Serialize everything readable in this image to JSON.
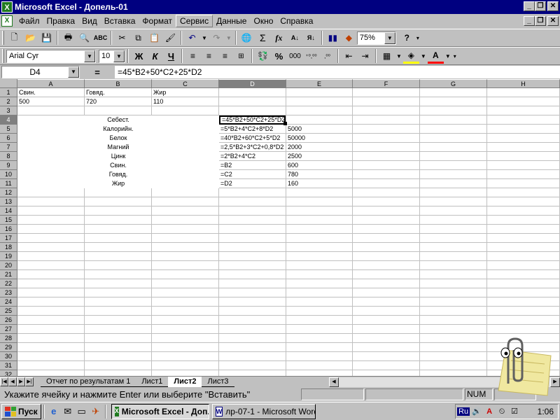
{
  "window": {
    "title": "Microsoft Excel - Допель-01",
    "app_icon": "X"
  },
  "menu": [
    "Файл",
    "Правка",
    "Вид",
    "Вставка",
    "Формат",
    "Сервис",
    "Данные",
    "Окно",
    "Справка"
  ],
  "toolbar": {
    "zoom": "75%",
    "font_name": "Arial Cyr",
    "font_size": "10",
    "bold": "Ж",
    "italic": "К",
    "underline": "Ч",
    "percent": "%",
    "thousands": "000",
    "inc_decimal": "⁺⁰,⁰⁰",
    "dec_decimal": ",⁰⁰",
    "sigma": "Σ",
    "fx": "fx"
  },
  "formula_bar": {
    "name_box": "D4",
    "equals": "=",
    "formula": "=45*B2+50*C2+25*D2"
  },
  "grid": {
    "columns": [
      "A",
      "B",
      "C",
      "D",
      "E",
      "F",
      "G",
      "H"
    ],
    "rows": [
      "1",
      "2",
      "3",
      "4",
      "5",
      "6",
      "7",
      "8",
      "9",
      "10",
      "11",
      "12",
      "13",
      "14",
      "15",
      "16",
      "17",
      "18",
      "19",
      "20",
      "21",
      "22",
      "23",
      "24",
      "25",
      "26",
      "27",
      "28",
      "29",
      "30",
      "31",
      "32"
    ],
    "cells": {
      "A1": "Свин.",
      "B1": "Говяд.",
      "C1": "Жир",
      "A2": "500",
      "B2": "720",
      "C2": "110",
      "B4": "Себест.",
      "D4": "=45*B2+50*C2+25*D2",
      "B5": "Калорийн.",
      "D5": "=5*B2+4*C2+8*D2",
      "E5": "5000",
      "B6": "Белок",
      "D6": "=40*B2+60*C2+5*D2",
      "E6": "50000",
      "B7": "Магний",
      "D7": "=2,5*B2+3*C2+0,8*D2",
      "E7": "2000",
      "B8": "Цинк",
      "D8": "=2*B2+4*C2",
      "E8": "2500",
      "B9": "Свин.",
      "D9": "=B2",
      "E9": "600",
      "B10": "Говяд.",
      "D10": "=C2",
      "E10": "780",
      "B11": "Жир",
      "D11": "=D2",
      "E11": "160"
    }
  },
  "sheet_tabs": [
    "Отчет по результатам 1",
    "Лист1",
    "Лист2",
    "Лист3"
  ],
  "active_tab": "Лист2",
  "status": {
    "message": "Укажите ячейку и нажмите Enter или выберите \"Вставить\"",
    "num": "NUM"
  },
  "taskbar": {
    "start": "Пуск",
    "tasks": [
      "Microsoft Excel - Доп...",
      "лр-07-1 - Microsoft Word"
    ],
    "lang": "Ru",
    "clock": "1:06"
  }
}
